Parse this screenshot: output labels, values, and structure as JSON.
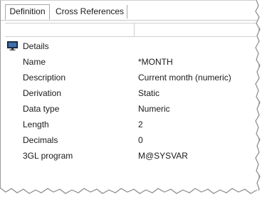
{
  "tabs": [
    {
      "label": "Definition",
      "active": true
    },
    {
      "label": "Cross References",
      "active": false
    }
  ],
  "group": {
    "label": "Details",
    "icon": "monitor-icon"
  },
  "properties": [
    {
      "name": "Name",
      "value": "*MONTH"
    },
    {
      "name": "Description",
      "value": "Current month (numeric)"
    },
    {
      "name": "Derivation",
      "value": "Static"
    },
    {
      "name": "Data type",
      "value": "Numeric"
    },
    {
      "name": "Length",
      "value": "2"
    },
    {
      "name": "Decimals",
      "value": "0"
    },
    {
      "name": "3GL program",
      "value": "M@SYSVAR"
    }
  ]
}
